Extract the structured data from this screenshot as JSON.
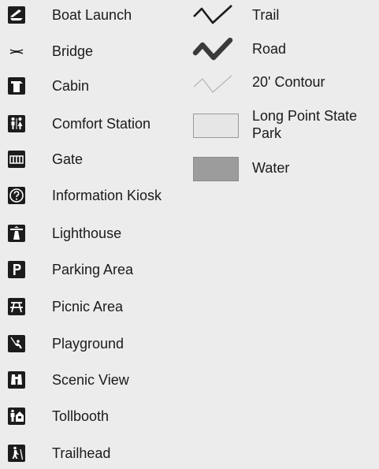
{
  "legend": {
    "symbols": [
      {
        "icon": "boat-launch-icon",
        "label": "Boat Launch"
      },
      {
        "icon": "bridge-icon",
        "label": "Bridge"
      },
      {
        "icon": "cabin-icon",
        "label": "Cabin"
      },
      {
        "icon": "comfort-station-icon",
        "label": "Comfort Station"
      },
      {
        "icon": "gate-icon",
        "label": "Gate"
      },
      {
        "icon": "information-kiosk-icon",
        "label": "Information Kiosk"
      },
      {
        "icon": "lighthouse-icon",
        "label": "Lighthouse"
      },
      {
        "icon": "parking-area-icon",
        "label": "Parking Area"
      },
      {
        "icon": "picnic-area-icon",
        "label": "Picnic Area"
      },
      {
        "icon": "playground-icon",
        "label": "Playground"
      },
      {
        "icon": "scenic-view-icon",
        "label": "Scenic View"
      },
      {
        "icon": "tollbooth-icon",
        "label": "Tollbooth"
      },
      {
        "icon": "trailhead-icon",
        "label": "Trailhead"
      }
    ],
    "lines_and_areas": [
      {
        "icon": "trail-line-icon",
        "label": "Trail"
      },
      {
        "icon": "road-line-icon",
        "label": "Road"
      },
      {
        "icon": "contour-line-icon",
        "label": "20' Contour"
      },
      {
        "icon": "state-park-area-icon",
        "label": "Long Point State Park"
      },
      {
        "icon": "water-area-icon",
        "label": "Water"
      }
    ]
  },
  "colors": {
    "icon_fill": "#1c1c1c",
    "road": "#3a3a3a",
    "contour": "#b4b4b4",
    "park_fill": "#e6e6e6",
    "water_fill": "#9c9c9c",
    "background": "#ececec"
  }
}
